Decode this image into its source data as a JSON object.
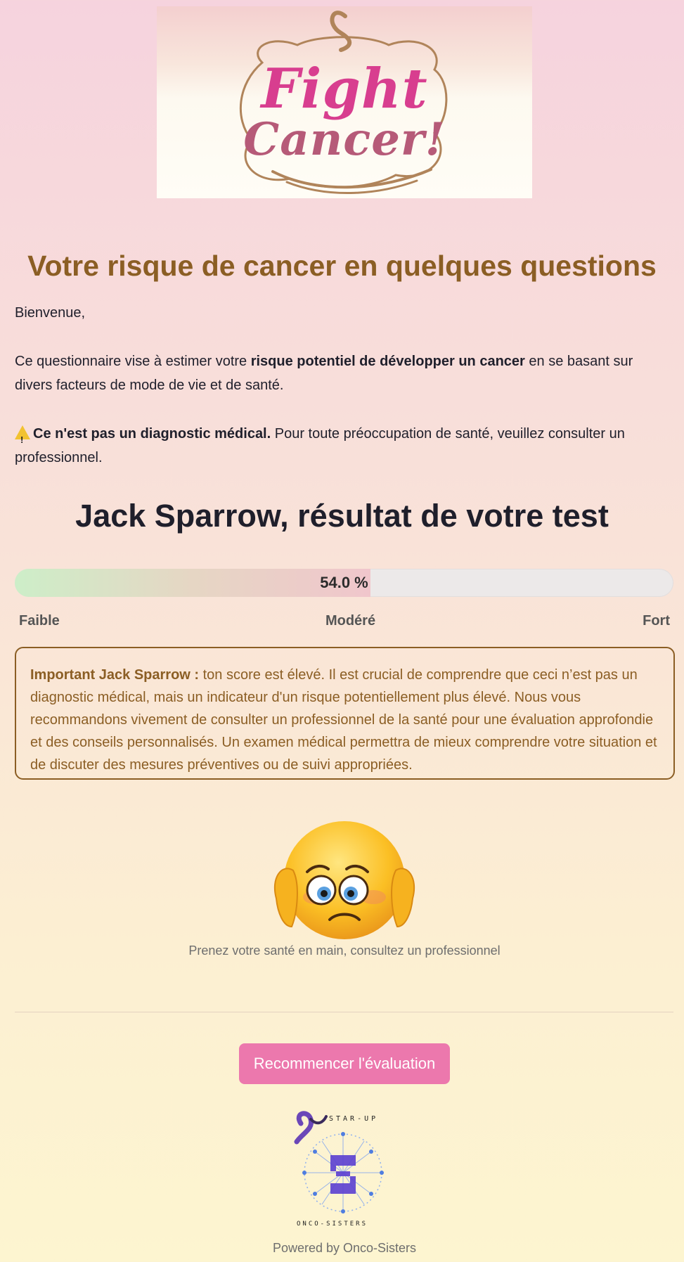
{
  "banner": {
    "line1": "Fight",
    "line2": "Cancer!",
    "ribbon_icon": "awareness-ribbon-icon"
  },
  "header": {
    "title": "Votre risque de cancer en quelques questions"
  },
  "intro": {
    "welcome": "Bienvenue,",
    "text_before": "Ce questionnaire vise à estimer votre ",
    "text_bold": "risque potentiel de développer un cancer",
    "text_after": " en se basant sur divers facteurs de mode de vie et de santé.",
    "warning_icon": "warning-icon",
    "warning_bold": "Ce n'est pas un diagnostic médical.",
    "warning_text": " Pour toute préoccupation de santé, veuillez consulter un professionnel."
  },
  "result": {
    "title": "Jack Sparrow, résultat de votre test",
    "score_label": "54.0 %",
    "score_fraction": 0.54,
    "scale_low": "Faible",
    "scale_mid": "Modéré",
    "scale_high": "Fort"
  },
  "alert": {
    "bold": "Important Jack Sparrow :",
    "text": " ton score est élevé. Il est crucial de comprendre que ceci n’est pas un diagnostic médical, mais un indicateur d'un risque potentiellement plus élevé. Nous vous recommandons vivement de consulter un professionnel de la santé pour une évaluation approfondie et des conseils personnalisés. Un examen médical permettra de mieux comprendre votre situation et de discuter des mesures préventives ou de suivi appropriées."
  },
  "emoji": {
    "icon": "worried-face-icon",
    "caption": "Prenez votre santé en main, consultez un professionnel"
  },
  "actions": {
    "restart_label": "Recommencer l'évaluation"
  },
  "footer": {
    "logo_icon": "onco-sisters-logo",
    "logo_text_top": "STAR-UP",
    "logo_text_bottom": "ONCO-SISTERS",
    "powered": "Powered by Onco-Sisters"
  },
  "colors": {
    "accent_brown": "#8b5e24",
    "button_pink": "#ec78ad",
    "banner_pink": "#d83e8f"
  }
}
